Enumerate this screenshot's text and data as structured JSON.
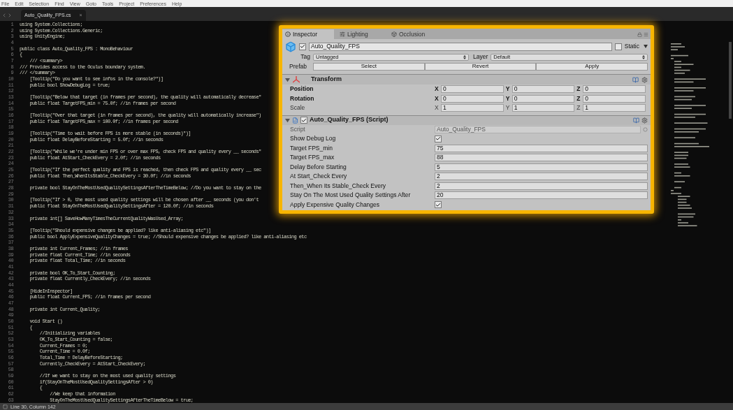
{
  "menu_bar": [
    "File",
    "Edit",
    "Selection",
    "Find",
    "View",
    "Goto",
    "Tools",
    "Project",
    "Preferences",
    "Help"
  ],
  "editor_tab": {
    "label": "Auto_Quality_FPS.cs",
    "close": "×"
  },
  "code_lines": [
    {
      "number": "1",
      "text": "using System.Collections;"
    },
    {
      "number": "2",
      "text": "using System.Collections.Generic;"
    },
    {
      "number": "3",
      "text": "using UnityEngine;"
    },
    {
      "number": "4"
    },
    {
      "number": "5",
      "text": "public class Auto_Quality_FPS : MonoBehaviour"
    },
    {
      "number": "6",
      "text": "{"
    },
    {
      "number": "7",
      "text": "    /// <summary>"
    },
    {
      "number": "8",
      "text": "/// Provides access to the Oculus boundary system."
    },
    {
      "number": "9",
      "text": "/// </summary>"
    },
    {
      "number": "10",
      "text": "    [Tooltip(\"Do you want to see infos in the console?\")]"
    },
    {
      "number": "11",
      "text": "    public bool ShowDebugLog = true;"
    },
    {
      "number": "12"
    },
    {
      "number": "13",
      "text": "    [Tooltip(\"Below that target (in frames per second), the quality will automatically decrease\""
    },
    {
      "number": "14",
      "text": "    public float TargetFPS_min = 75.0f; //in frames per second"
    },
    {
      "number": "15"
    },
    {
      "number": "16",
      "text": "    [Tooltip(\"Over that target (in frames per second), the quality will automatically increase\")"
    },
    {
      "number": "17",
      "text": "    public float TargetFPS_max = 100.0f; //in frames per second"
    },
    {
      "number": "18"
    },
    {
      "number": "19",
      "text": "    [Tooltip(\"Time to wait before FPS is more stable (in seconds)\")]"
    },
    {
      "number": "20",
      "text": "    public float DelayBeforeStarting = 5.0f; //in seconds"
    },
    {
      "number": "21"
    },
    {
      "number": "22",
      "text": "    [Tooltip(\"While we're under min FPS or over max FPS, check FPS and quality every __ seconds\""
    },
    {
      "number": "23",
      "text": "    public float AtStart_CheckEvery = 2.0f; //in seconds"
    },
    {
      "number": "24"
    },
    {
      "number": "25",
      "text": "    [Tooltip(\"If the perfect quality and FPS is reached, then check FPS and quality every __ sec"
    },
    {
      "number": "26",
      "text": "    public float Then_WhenItsStable_CheckEvery = 30.0f; //in seconds"
    },
    {
      "number": "27"
    },
    {
      "number": "28",
      "text": "    private bool StayOnTheMostUsedQualitySettingsAfterTheTimeBelow; //Do you want to stay on the"
    },
    {
      "number": "29"
    },
    {
      "number": "30",
      "text": "    [Tooltip(\"If > 0, the most used quality settings will be chosen after __ seconds (you don't"
    },
    {
      "number": "31",
      "text": "    public float StayOnTheMostUsedQualitySettingsAfter = 120.0f; //in seconds"
    },
    {
      "number": "32"
    },
    {
      "number": "33",
      "text": "    private int[] SaveHowManyTimesTheCurrentQualityWasUsed_Array;"
    },
    {
      "number": "34"
    },
    {
      "number": "35",
      "text": "    [Tooltip(\"Should expensive changes be applied? like anti-aliasing etc\")]"
    },
    {
      "number": "36",
      "text": "    public bool ApplyExpensiveQualityChanges = true; //Should expensive changes be applied? like anti-aliasing etc"
    },
    {
      "number": "37"
    },
    {
      "number": "38",
      "text": "    private int Current_Frames; //in frames"
    },
    {
      "number": "39",
      "text": "    private float Current_Time; //in seconds"
    },
    {
      "number": "40",
      "text": "    private float Total_Time; //in seconds"
    },
    {
      "number": "41"
    },
    {
      "number": "42",
      "text": "    private bool OK_To_Start_Counting;"
    },
    {
      "number": "43",
      "text": "    private float Currently_CheckEvery; //in seconds"
    },
    {
      "number": "44"
    },
    {
      "number": "45",
      "text": "    [HideInInspector]"
    },
    {
      "number": "46",
      "text": "    public float Current_FPS; //in frames per second"
    },
    {
      "number": "47"
    },
    {
      "number": "48",
      "text": "    private int Current_Quality;"
    },
    {
      "number": "49"
    },
    {
      "number": "50",
      "text": "    void Start ()"
    },
    {
      "number": "51",
      "text": "    {"
    },
    {
      "number": "52",
      "text": "        //Initializing variables"
    },
    {
      "number": "53",
      "text": "        OK_To_Start_Counting = false;"
    },
    {
      "number": "54",
      "text": "        Current_Frames = 0;"
    },
    {
      "number": "55",
      "text": "        Current_Time = 0.0f;"
    },
    {
      "number": "56",
      "text": "        Total_Time = DelayBeforeStarting;"
    },
    {
      "number": "57",
      "text": "        Currently_CheckEvery = AtStart_CheckEvery;"
    },
    {
      "number": "58"
    },
    {
      "number": "59",
      "text": "        //If we want to stay on the most used quality settings"
    },
    {
      "number": "60",
      "text": "        if(StayOnTheMostUsedQualitySettingsAfter > 0)"
    },
    {
      "number": "61",
      "text": "        {"
    },
    {
      "number": "62",
      "text": "            //We keep that information"
    },
    {
      "number": "63",
      "text": "            StayOnTheMostUsedQualitySettingsAfterTheTimeBelow = true;"
    }
  ],
  "inspector": {
    "tabs": [
      {
        "label": "Inspector",
        "selected": true
      },
      {
        "label": "Lighting",
        "selected": false
      },
      {
        "label": "Occlusion",
        "selected": false
      }
    ],
    "object": {
      "active": true,
      "name": "Auto_Quality_FPS",
      "static_label": "Static",
      "static": false,
      "tag_label": "Tag",
      "tag": "Untagged",
      "layer_label": "Layer",
      "layer": "Default",
      "prefab_label": "Prefab",
      "prefab_buttons": [
        "Select",
        "Revert",
        "Apply"
      ]
    },
    "transform": {
      "title": "Transform",
      "expanded": true,
      "rows": [
        {
          "label": "Position",
          "bold": true,
          "axes": [
            {
              "axis": "X",
              "value": "0"
            },
            {
              "axis": "Y",
              "value": "0"
            },
            {
              "axis": "Z",
              "value": "0"
            }
          ]
        },
        {
          "label": "Rotation",
          "bold": true,
          "axes": [
            {
              "axis": "X",
              "value": "0"
            },
            {
              "axis": "Y",
              "value": "0"
            },
            {
              "axis": "Z",
              "value": "0"
            }
          ]
        },
        {
          "label": "Scale",
          "bold": false,
          "axes": [
            {
              "axis": "X",
              "value": "1"
            },
            {
              "axis": "Y",
              "value": "1"
            },
            {
              "axis": "Z",
              "value": "1"
            }
          ]
        }
      ]
    },
    "script": {
      "title": "Auto_Quality_FPS (Script)",
      "enabled": true,
      "expanded": true,
      "fields": [
        {
          "kind": "object",
          "label": "Script",
          "value": "Auto_Quality_FPS",
          "disabled": true
        },
        {
          "kind": "checkbox",
          "label": "Show Debug Log",
          "checked": true
        },
        {
          "kind": "number",
          "label": "Target FPS_min",
          "value": "75"
        },
        {
          "kind": "number",
          "label": "Target FPS_max",
          "value": "88"
        },
        {
          "kind": "number",
          "label": "Delay Before Starting",
          "value": "5"
        },
        {
          "kind": "number",
          "label": "At Start_Check Every",
          "value": "2"
        },
        {
          "kind": "number",
          "label": "Then_When Its Stable_Check Every",
          "value": "2"
        },
        {
          "kind": "number",
          "label": "Stay On The Most Used Quality Settings After",
          "value": "20"
        },
        {
          "kind": "checkbox",
          "label": "Apply Expensive Quality Changes",
          "checked": true
        }
      ]
    }
  },
  "status_bar": {
    "text": "Line 30, Column 142"
  }
}
